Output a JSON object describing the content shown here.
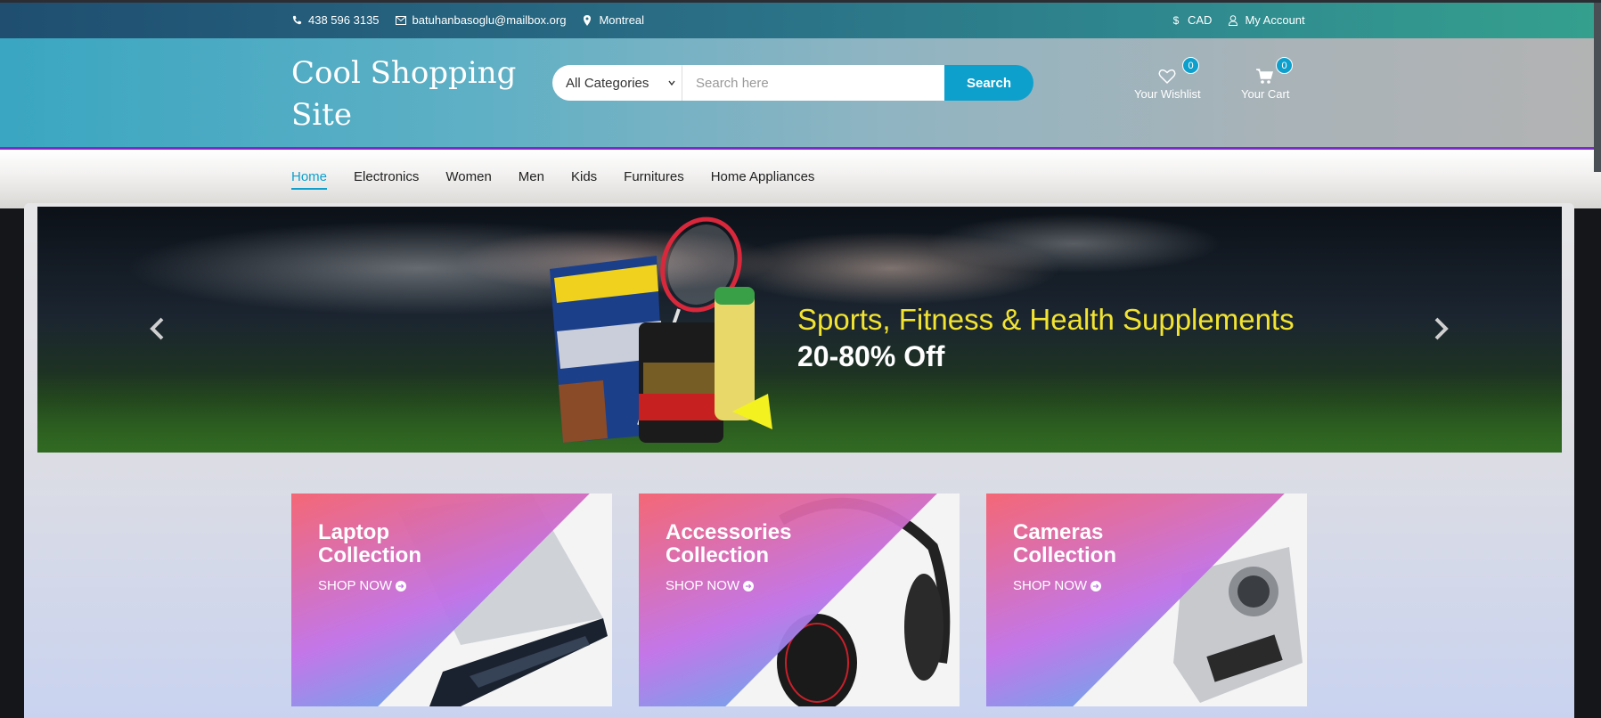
{
  "topbar": {
    "phone": "438 596 3135",
    "email": "batuhanbasoglu@mailbox.org",
    "location": "Montreal",
    "currency": "CAD",
    "account": "My Account"
  },
  "header": {
    "logo": "Cool Shopping Site",
    "category_selected": "All Categories",
    "search_placeholder": "Search here",
    "search_button": "Search",
    "wishlist_label": "Your Wishlist",
    "wishlist_count": "0",
    "cart_label": "Your Cart",
    "cart_count": "0"
  },
  "nav": {
    "items": [
      "Home",
      "Electronics",
      "Women",
      "Men",
      "Kids",
      "Furnitures",
      "Home Appliances"
    ]
  },
  "slider": {
    "title": "Sports, Fitness & Health Supplements",
    "subtitle": "20-80% Off",
    "prev_icon": "chevron-left-icon",
    "next_icon": "chevron-right-icon"
  },
  "collections": [
    {
      "title_line1": "Laptop",
      "title_line2": "Collection",
      "cta": "SHOP NOW"
    },
    {
      "title_line1": "Accessories",
      "title_line2": "Collection",
      "cta": "SHOP NOW"
    },
    {
      "title_line1": "Cameras",
      "title_line2": "Collection",
      "cta": "SHOP NOW"
    }
  ],
  "colors": {
    "accent": "#0ea0cc",
    "nav_border": "#7c2cc7",
    "slide_title": "#f2e431"
  }
}
